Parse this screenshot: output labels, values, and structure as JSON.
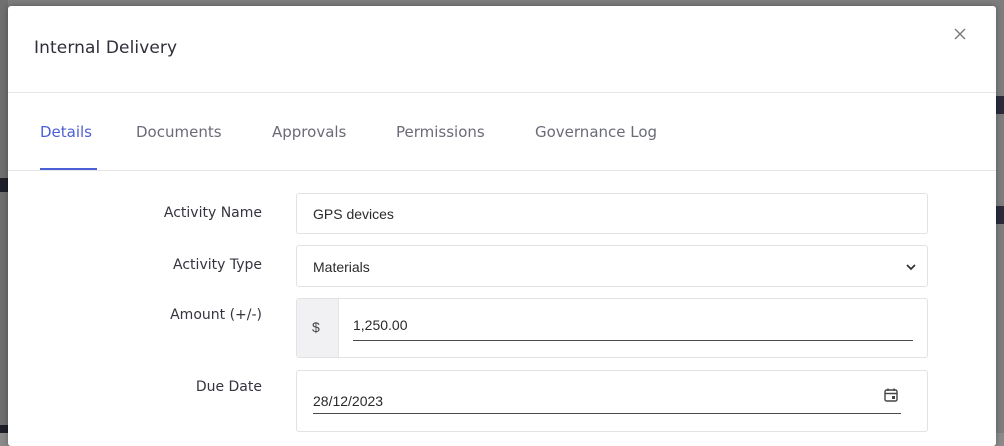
{
  "modal": {
    "title": "Internal Delivery",
    "close_icon": "close-icon"
  },
  "tabs": [
    {
      "label": "Details",
      "active": true
    },
    {
      "label": "Documents",
      "active": false
    },
    {
      "label": "Approvals",
      "active": false
    },
    {
      "label": "Permissions",
      "active": false
    },
    {
      "label": "Governance Log",
      "active": false
    }
  ],
  "form": {
    "activity_name": {
      "label": "Activity Name",
      "value": "GPS devices"
    },
    "activity_type": {
      "label": "Activity Type",
      "value": "Materials",
      "icon": "chevron-down-icon"
    },
    "amount": {
      "label": "Amount (+/-)",
      "prefix": "$",
      "value": "1,250.00"
    },
    "due_date": {
      "label": "Due Date",
      "value": "28/12/2023",
      "icon": "calendar-icon"
    }
  },
  "colors": {
    "accent": "#4b5fd6",
    "text": "#34343f",
    "muted_tab": "#6b6b78",
    "border": "#e2e2e6"
  }
}
